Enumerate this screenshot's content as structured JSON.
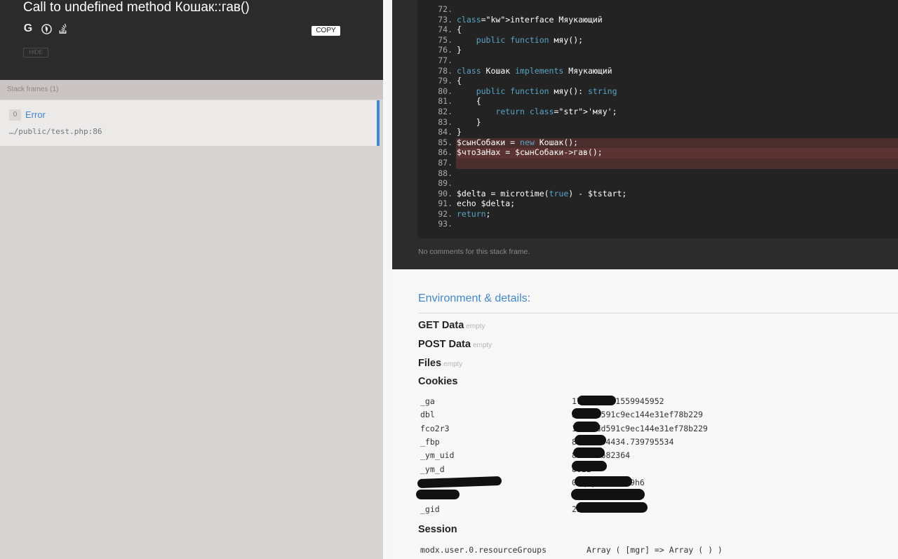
{
  "header": {
    "title": "Call to undefined method Кошак::гав()",
    "copy_label": "COPY",
    "hide_label": "HIDE",
    "google_glyph": "G"
  },
  "frames": {
    "label": "Stack frames (1)",
    "items": [
      {
        "index": "0",
        "class": "Error",
        "file": "…/public/test.php:86"
      }
    ]
  },
  "code": {
    "highlight_line": "86",
    "lines": [
      {
        "n": "72.",
        "t": ""
      },
      {
        "n": "73.",
        "t": "interface Мяукающий"
      },
      {
        "n": "74.",
        "t": "{"
      },
      {
        "n": "75.",
        "t": "    public function мяу();"
      },
      {
        "n": "76.",
        "t": "}"
      },
      {
        "n": "77.",
        "t": ""
      },
      {
        "n": "78.",
        "t": "class Кошак implements Мяукающий"
      },
      {
        "n": "79.",
        "t": "{"
      },
      {
        "n": "80.",
        "t": "    public function мяу(): string"
      },
      {
        "n": "81.",
        "t": "    {"
      },
      {
        "n": "82.",
        "t": "        return 'мяу';"
      },
      {
        "n": "83.",
        "t": "    }"
      },
      {
        "n": "84.",
        "t": "}"
      },
      {
        "n": "85.",
        "t": "$сынСобаки = new Кошак();"
      },
      {
        "n": "86.",
        "t": "$чтоЗаНах = $сынСобаки->гав();"
      },
      {
        "n": "87.",
        "t": ""
      },
      {
        "n": "88.",
        "t": ""
      },
      {
        "n": "89.",
        "t": ""
      },
      {
        "n": "90.",
        "t": "$delta = microtime(true) - $tstart;"
      },
      {
        "n": "91.",
        "t": "echo $delta;"
      },
      {
        "n": "92.",
        "t": "return;"
      },
      {
        "n": "93.",
        "t": ""
      }
    ],
    "no_comments": "No comments for this stack frame."
  },
  "env": {
    "title": "Environment & details:",
    "get_label": "GET Data",
    "get_empty": "empty",
    "post_label": "POST Data",
    "post_empty": "empty",
    "files_label": "Files",
    "files_empty": "empty",
    "cookies_label": "Cookies",
    "cookies": [
      {
        "key": "_ga",
        "value": "17661201.1559945952"
      },
      {
        "key": "dbl",
        "value": "3a3edd591c9ec144e31ef78b229"
      },
      {
        "key": "fco2r3",
        "value": "13a3edd591c9ec144e31ef78b229"
      },
      {
        "key": "_fbp",
        "value": "85575304434.739795534"
      },
      {
        "key": "_ym_uid",
        "value": "862234682364"
      },
      {
        "key": "_ym_d",
        "value": "8622"
      },
      {
        "key": "",
        "value": "0uq6jusa92vu9h6"
      },
      {
        "key": "",
        "value": "cu4ommirh11dc"
      },
      {
        "key": "_gid",
        "value": "25.1586271882"
      }
    ],
    "session_label": "Session",
    "session": [
      {
        "key": "modx.user.0.resourceGroups",
        "value": "Array ( [mgr] => Array ( ) )"
      }
    ]
  }
}
